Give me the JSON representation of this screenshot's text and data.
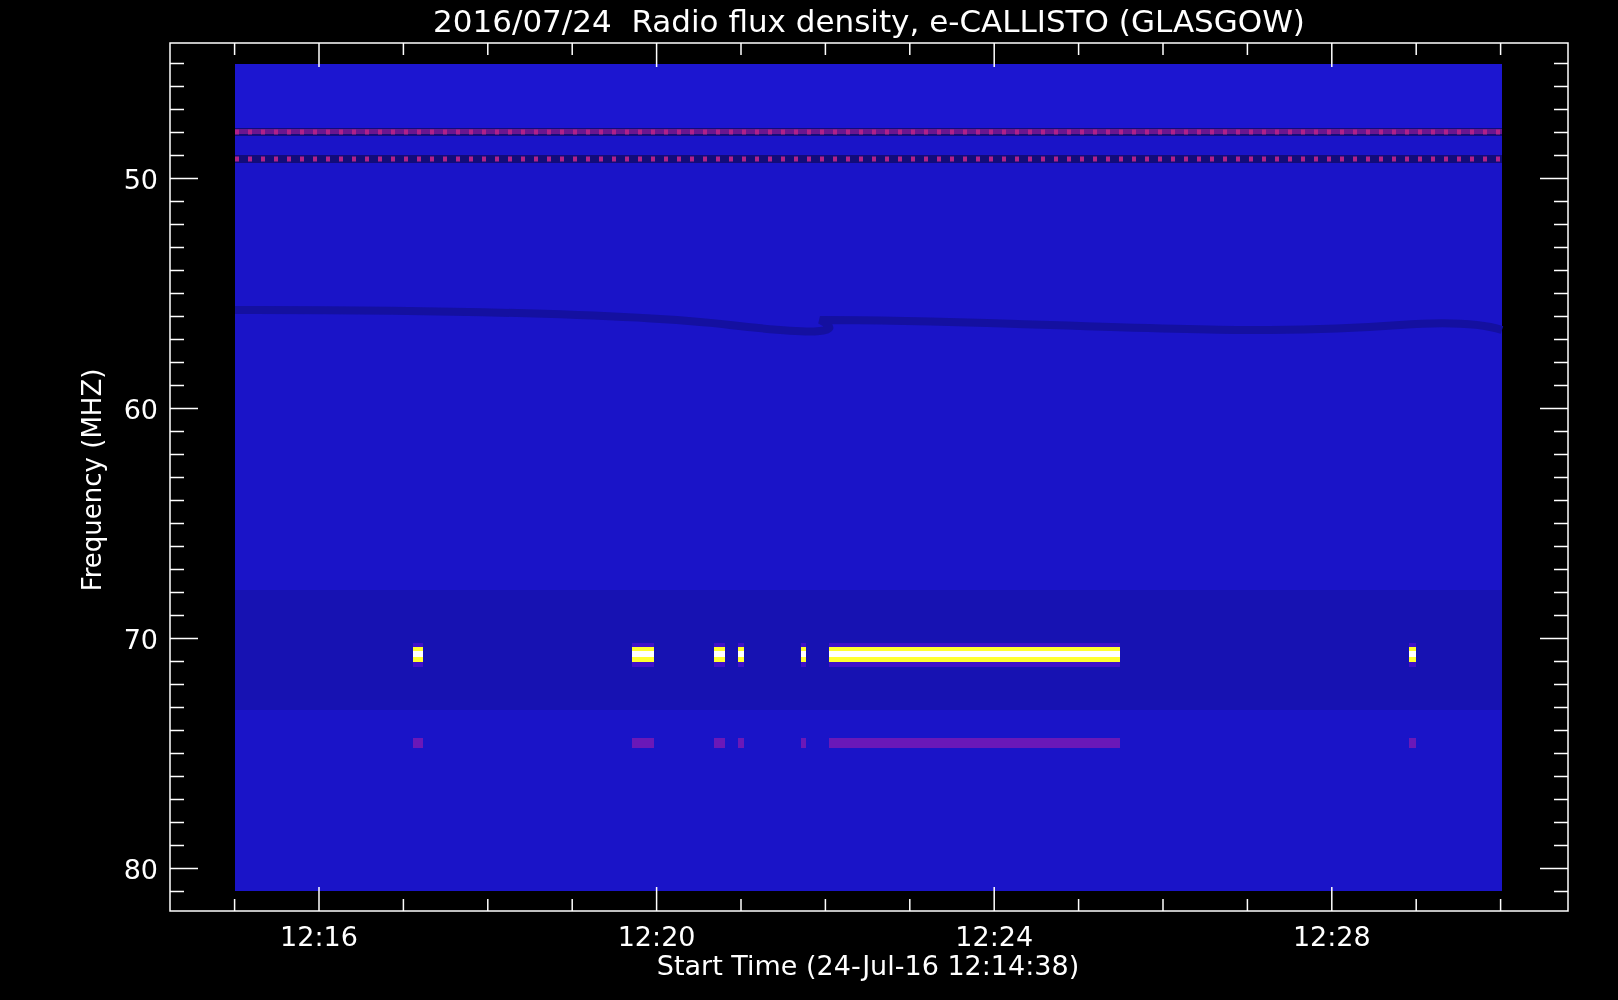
{
  "title": "2016/07/24  Radio flux density, e-CALLISTO (GLASGOW)",
  "y_axis": {
    "label": "Frequency (MHZ)",
    "ticks": [
      "50",
      "60",
      "70",
      "80"
    ]
  },
  "x_axis": {
    "label": "Start Time (24-Jul-16 12:14:38)",
    "ticks": [
      "12:16",
      "12:20",
      "12:24",
      "12:28"
    ]
  }
}
